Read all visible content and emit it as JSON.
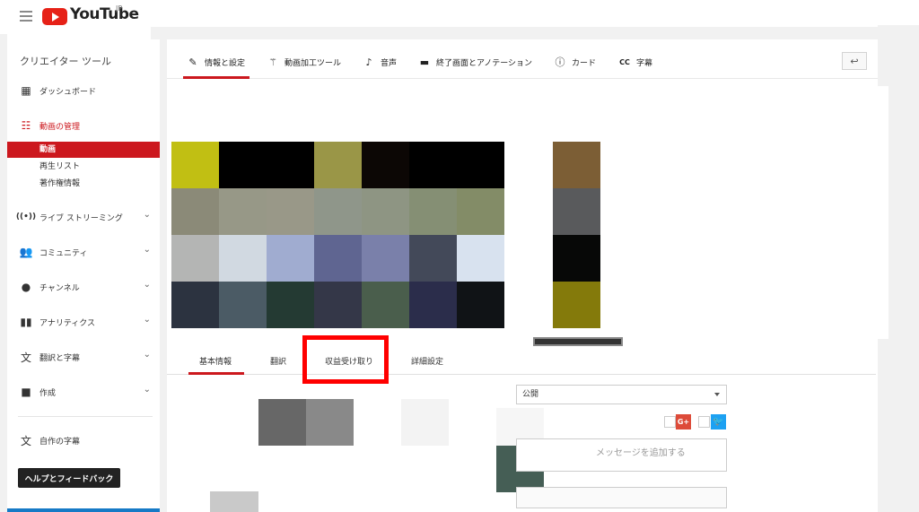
{
  "header": {
    "logo_text": "YouTube",
    "region": "JP"
  },
  "sidebar": {
    "title": "クリエイター ツール",
    "items": [
      {
        "label": "ダッシュボード",
        "icon": "dashboard-icon"
      },
      {
        "label": "動画の管理",
        "icon": "video-manager-icon"
      },
      {
        "label": "ライブ ストリーミング",
        "icon": "live-streaming-icon"
      },
      {
        "label": "コミュニティ",
        "icon": "community-icon"
      },
      {
        "label": "チャンネル",
        "icon": "channel-icon"
      },
      {
        "label": "アナリティクス",
        "icon": "analytics-icon"
      },
      {
        "label": "翻訳と字幕",
        "icon": "translate-icon"
      },
      {
        "label": "作成",
        "icon": "create-icon"
      },
      {
        "label": "自作の字幕",
        "icon": "translate-icon"
      }
    ],
    "sub_items": [
      "動画",
      "再生リスト",
      "著作権情報"
    ],
    "help_button": "ヘルプとフィードバック"
  },
  "main": {
    "tabs": [
      {
        "label": "情報と設定",
        "icon": "pencil-icon"
      },
      {
        "label": "動画加工ツール",
        "icon": "magic-wand-icon"
      },
      {
        "label": "音声",
        "icon": "music-note-icon"
      },
      {
        "label": "終了画面とアノテーション",
        "icon": "end-screen-icon"
      },
      {
        "label": "カード",
        "icon": "info-icon"
      },
      {
        "label": "字幕",
        "icon": "cc-icon"
      }
    ],
    "back_icon": "back-arrow-icon",
    "sub_tabs": [
      "基本情報",
      "翻訳",
      "収益受け取り",
      "詳細設定"
    ],
    "visibility": "公開",
    "message_placeholder": "メッセージを追加する",
    "social": {
      "gplus": "G+"
    }
  },
  "colors": {
    "accent": "#cc181e",
    "highlight": "#ff0000"
  }
}
